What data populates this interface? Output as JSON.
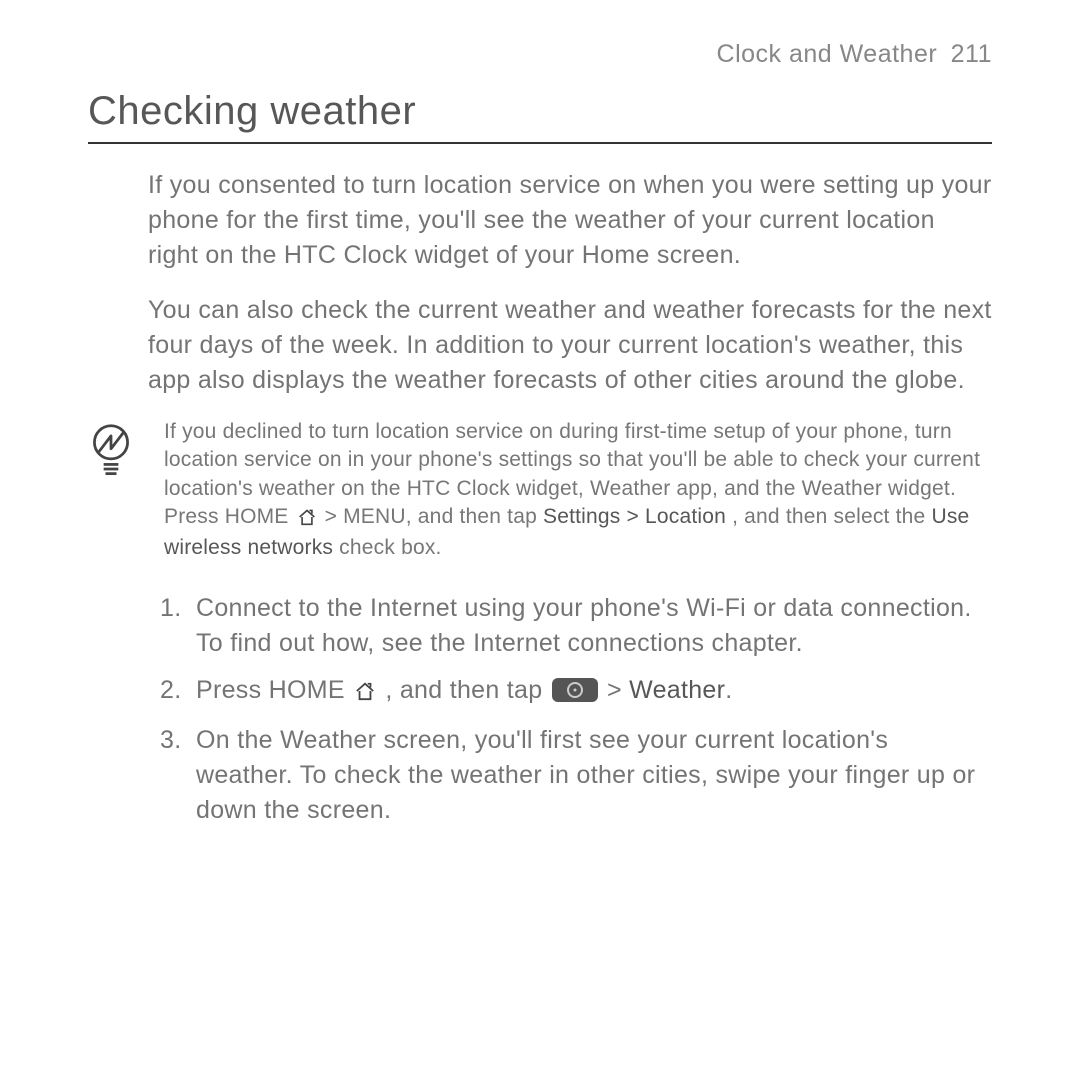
{
  "header": {
    "section": "Clock and Weather",
    "page": "211"
  },
  "title": "Checking weather",
  "intro1": "If you consented to turn location service on when you were setting up your phone for the first time, you'll see the weather of your current location right on the HTC Clock widget of your Home screen.",
  "intro2": "You can also check the current weather and weather forecasts for the next four days of the week. In addition to your current location's weather, this app also displays the weather forecasts of other cities around the globe.",
  "tip": {
    "part1": "If you declined to turn location service on during first-time setup of your phone, turn location service on in your phone's settings so that you'll be able to check your current location's weather on the HTC Clock widget, Weather app, and the Weather widget. Press HOME ",
    "part2": " > MENU, and then tap ",
    "settings_path": "Settings > Location",
    "part3": ", and then select the ",
    "option": "Use wireless networks",
    "part4": " check box."
  },
  "steps": {
    "s1": "Connect to the Internet using your phone's Wi-Fi or data connection. To find out how, see the Internet connections chapter.",
    "s2_a": "Press HOME ",
    "s2_b": ", and then tap ",
    "s2_c": " > ",
    "s2_weather": "Weather",
    "s2_d": ".",
    "s3": "On the Weather screen, you'll first see your current location's weather. To check the weather in other cities, swipe your finger up or down the screen."
  }
}
